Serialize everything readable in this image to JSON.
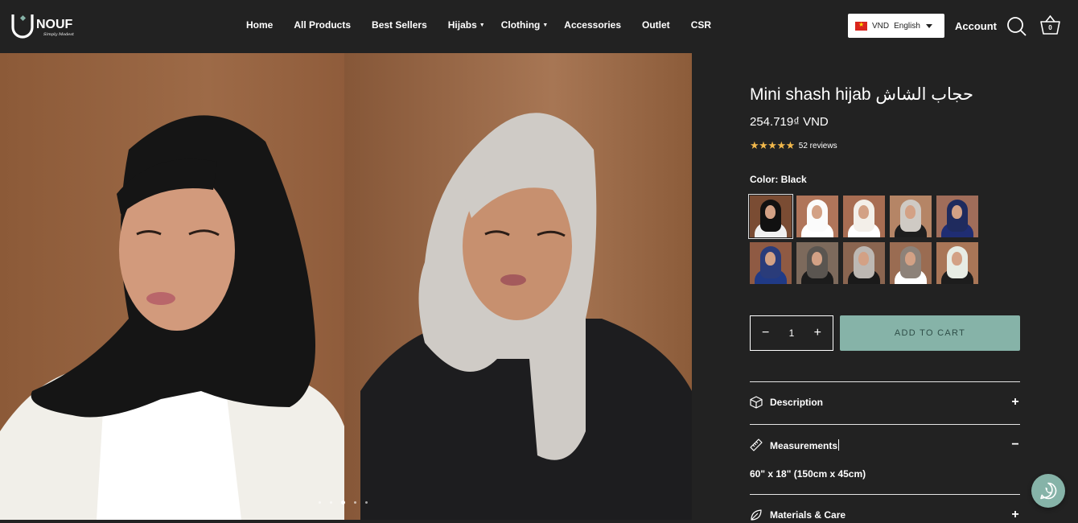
{
  "brand": {
    "name": "NOUF",
    "tagline": "Simply Modest"
  },
  "nav": {
    "items": [
      {
        "label": "Home"
      },
      {
        "label": "All Products"
      },
      {
        "label": "Best Sellers"
      },
      {
        "label": "Hijabs",
        "has_dropdown": true
      },
      {
        "label": "Clothing",
        "has_dropdown": true
      },
      {
        "label": "Accessories"
      },
      {
        "label": "Outlet"
      },
      {
        "label": "CSR"
      }
    ]
  },
  "header": {
    "currency": "VND",
    "language": "English",
    "account_label": "Account",
    "cart_count": "0",
    "icons": {
      "search": "search-icon",
      "cart": "basket-icon",
      "flag": "vietnam-flag-icon"
    }
  },
  "gallery": {
    "slide_count": 5,
    "active_slide": 3
  },
  "product": {
    "title": "Mini shash hijab حجاب الشاش",
    "price": "254.719₫ VND",
    "rating_stars": "★★★★★",
    "rating_value": 5,
    "reviews_label": "52 reviews",
    "color_label": "Color: Black",
    "selected_color_index": 0,
    "swatch_count": 10,
    "quantity": "1",
    "add_to_cart_label": "ADD TO CART"
  },
  "accordion": [
    {
      "title": "Description",
      "icon": "box-icon",
      "toggle": "+",
      "expanded": false
    },
    {
      "title": "Measurements",
      "icon": "ruler-icon",
      "toggle": "−",
      "expanded": true,
      "body": "60\" x 18\" (150cm x 45cm)"
    },
    {
      "title": "Materials & Care",
      "icon": "leaf-icon",
      "toggle": "+",
      "expanded": false
    }
  ],
  "colors": {
    "background": "#222222",
    "accent": "#86b3a8",
    "star": "#f2b84b",
    "text": "#ffffff"
  },
  "chat": {
    "icon": "whatsapp-icon"
  }
}
